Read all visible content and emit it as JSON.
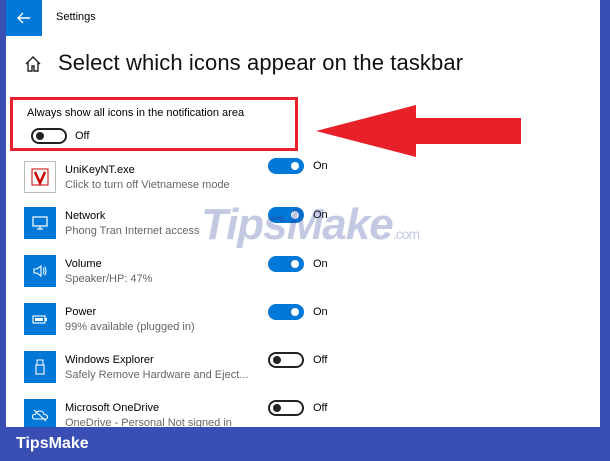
{
  "window": {
    "title": "Settings"
  },
  "page": {
    "title": "Select which icons appear on the taskbar"
  },
  "always_show": {
    "label": "Always show all icons in the notification area",
    "state": "Off"
  },
  "apps": [
    {
      "name": "UniKeyNT.exe",
      "description": "Click to turn off Vietnamese mode",
      "state": "On",
      "icon": "unikey-icon"
    },
    {
      "name": "Network",
      "description": "Phong Tran Internet access",
      "state": "On",
      "icon": "network-icon"
    },
    {
      "name": "Volume",
      "description": "Speaker/HP: 47%",
      "state": "On",
      "icon": "speaker-icon"
    },
    {
      "name": "Power",
      "description": "99% available (plugged in)",
      "state": "On",
      "icon": "battery-icon"
    },
    {
      "name": "Windows Explorer",
      "description": "Safely Remove Hardware and Eject...",
      "state": "Off",
      "icon": "usb-icon"
    },
    {
      "name": "Microsoft OneDrive",
      "description": "OneDrive - Personal Not signed in",
      "state": "Off",
      "icon": "onedrive-icon"
    }
  ],
  "watermark": {
    "text": "TipsMake",
    "suffix": ".com"
  },
  "brand": {
    "text": "TipsMake"
  },
  "colors": {
    "accent": "#0078d7",
    "highlight": "#e8202a",
    "brand_bar": "#3a4fb3"
  }
}
